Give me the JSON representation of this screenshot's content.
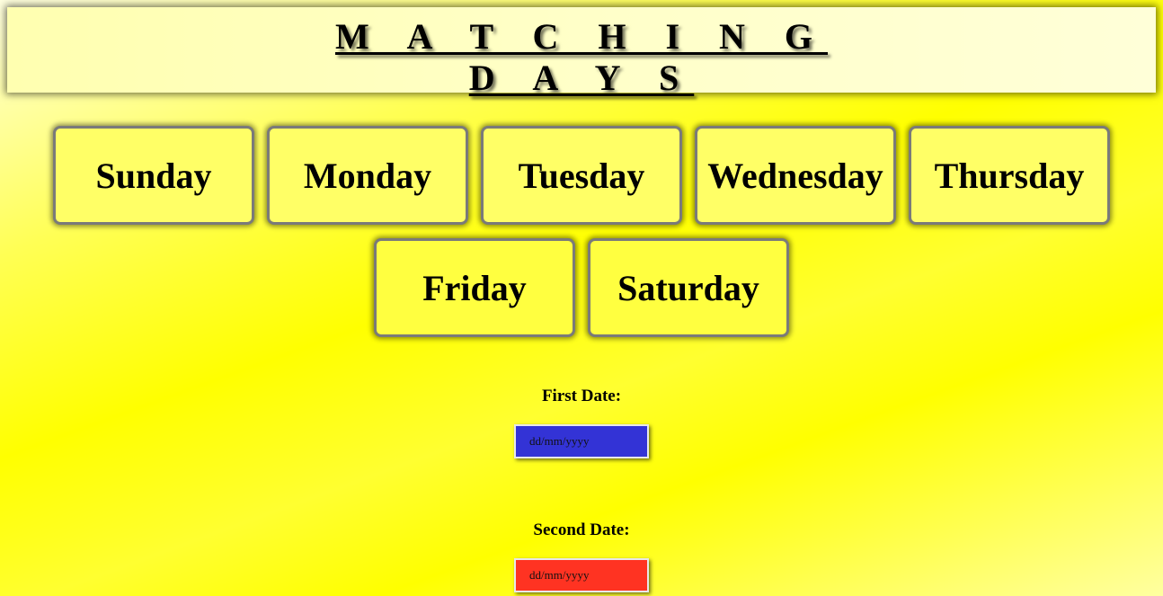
{
  "header": {
    "title_line1": "M A T C H I N G",
    "title_line2": "D A Y S"
  },
  "days": [
    {
      "label": "Sunday"
    },
    {
      "label": "Monday"
    },
    {
      "label": "Tuesday"
    },
    {
      "label": "Wednesday"
    },
    {
      "label": "Thursday"
    },
    {
      "label": "Friday"
    },
    {
      "label": "Saturday"
    }
  ],
  "first_date": {
    "label": "First Date:",
    "placeholder": "dd/mm/yyyy",
    "color": "#3333d6"
  },
  "second_date": {
    "label": "Second Date:",
    "placeholder": "dd/mm/yyyy",
    "color": "#ff3322"
  },
  "colors": {
    "background": "#ffff00",
    "card": "#ffff66"
  }
}
